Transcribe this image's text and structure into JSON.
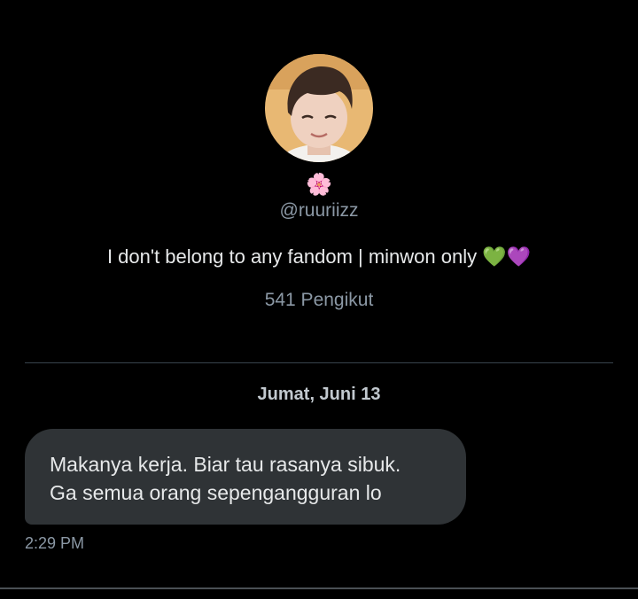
{
  "profile": {
    "avatar_icon": "profile-photo",
    "name_emoji": "🌸",
    "handle": "@ruuriizz",
    "bio": "I don't belong to any fandom | minwon only 💚💜",
    "followers": "541 Pengikut"
  },
  "conversation": {
    "date_label": "Jumat, Juni 13",
    "messages": [
      {
        "lines": [
          "Makanya kerja. Biar tau rasanya sibuk.",
          "Ga semua orang sepengangguran lo"
        ],
        "time": "2:29 PM"
      }
    ]
  },
  "colors": {
    "background": "#000000",
    "bubble": "#2f3336",
    "text_primary": "#e7e9ea",
    "text_secondary": "#8b98a5",
    "divider": "#38444d"
  }
}
